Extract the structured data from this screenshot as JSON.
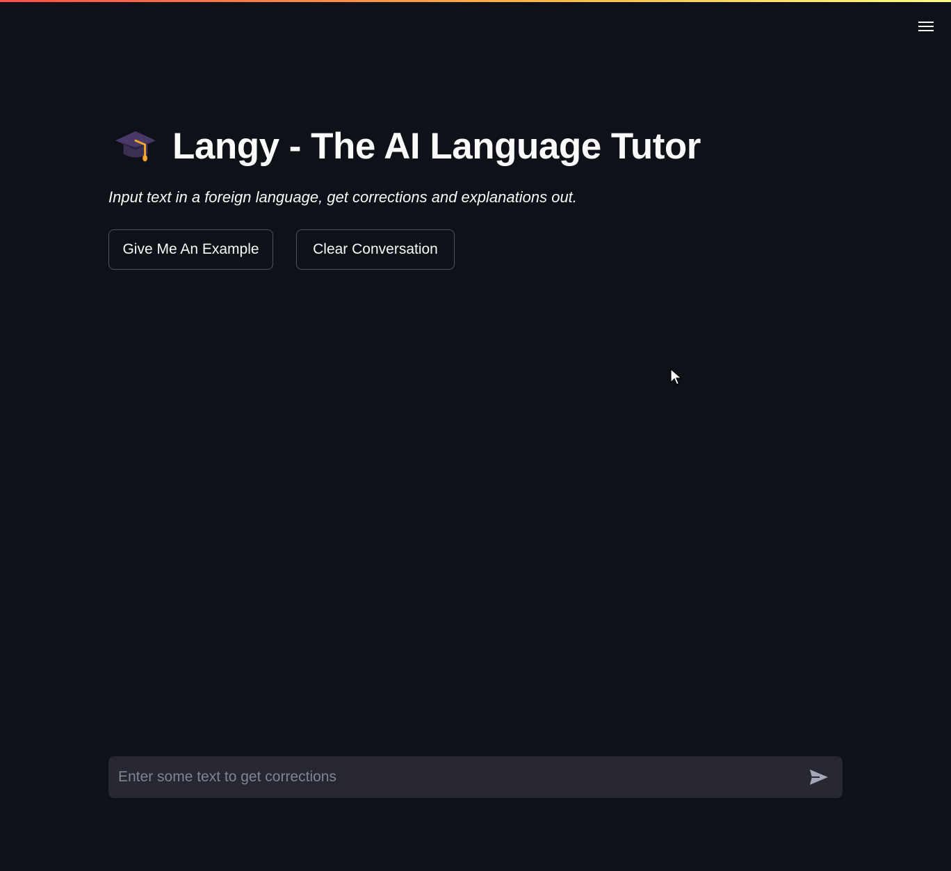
{
  "app": {
    "title_icon": "graduation-cap-icon",
    "title": "Langy - The AI Language Tutor",
    "subtitle": "Input text in a foreign language, get corrections and explanations out."
  },
  "header": {
    "menu_icon": "hamburger-menu-icon"
  },
  "actions": {
    "example_label": "Give Me An Example",
    "clear_label": "Clear Conversation"
  },
  "chat_input": {
    "value": "",
    "placeholder": "Enter some text to get corrections",
    "send_icon": "send-arrow-icon"
  },
  "colors": {
    "background": "#0e1117",
    "input_background": "#262730",
    "text": "#fafafa",
    "accent_gradient_start": "#ff4b4b",
    "accent_gradient_end": "#fffd80"
  }
}
